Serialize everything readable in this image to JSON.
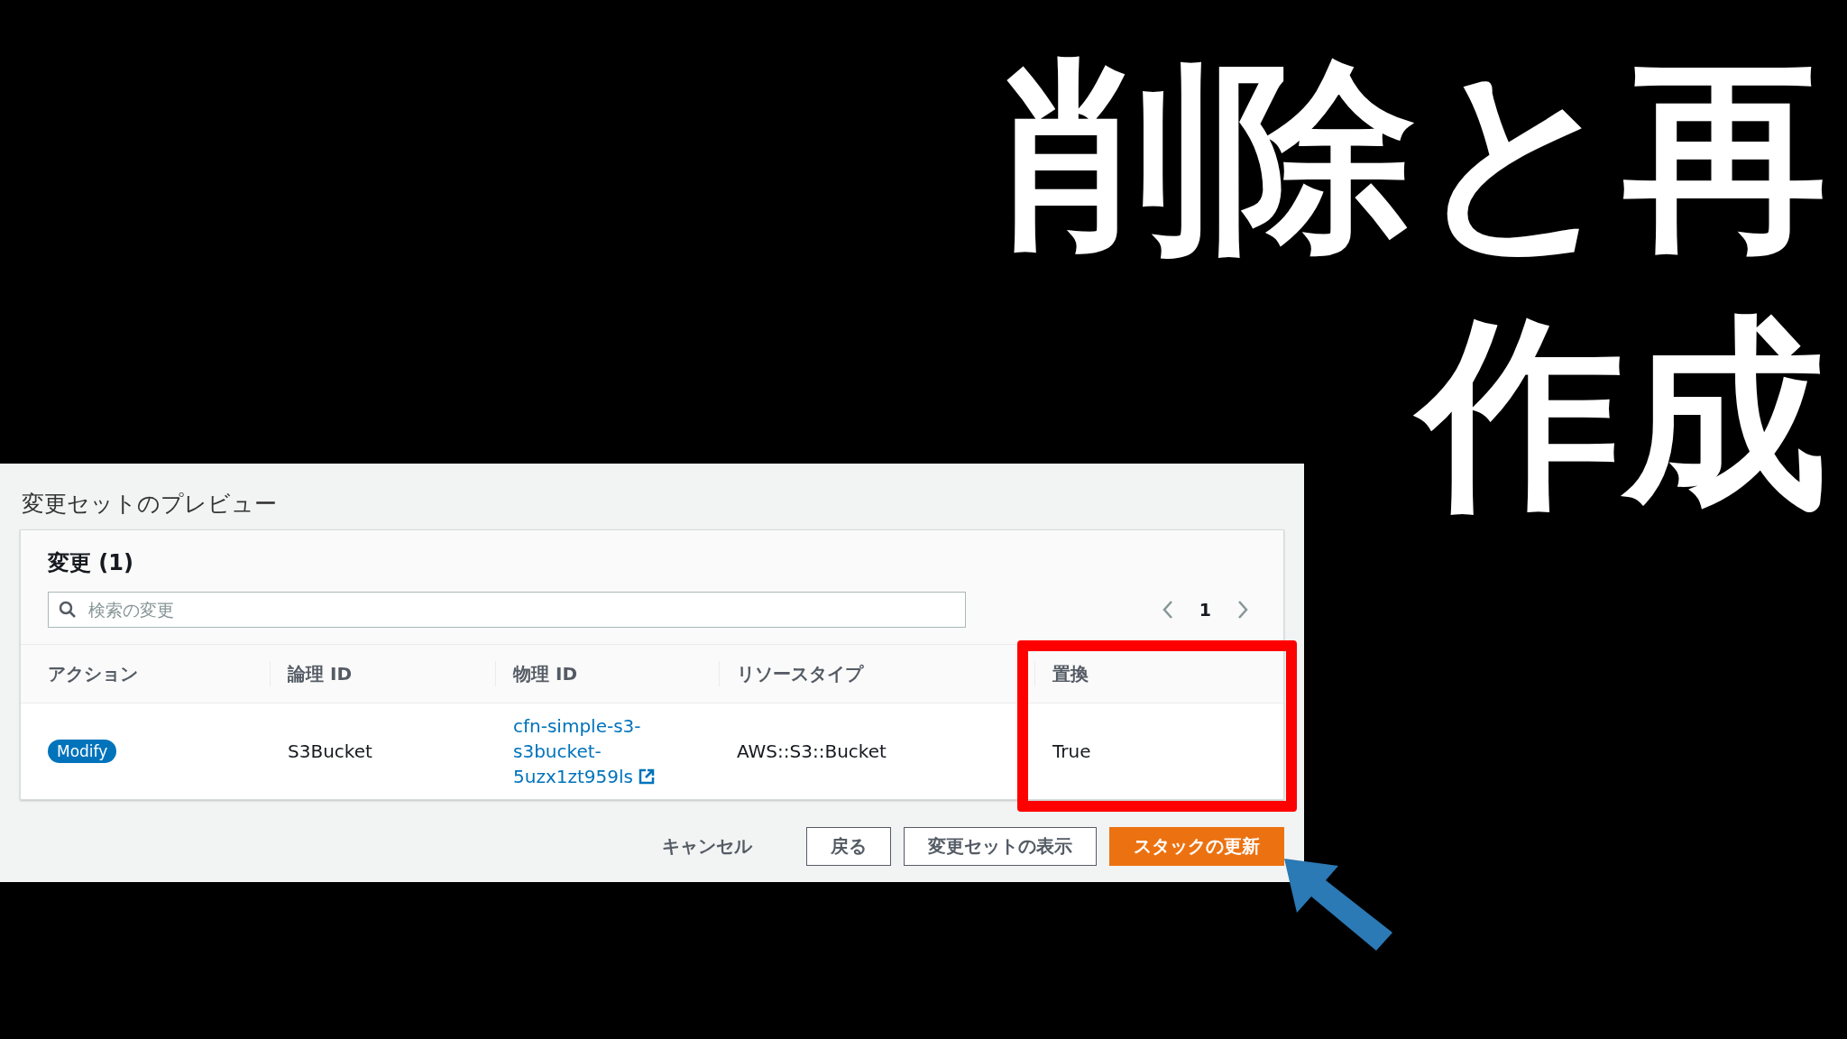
{
  "headline": {
    "lines": [
      "削除と再",
      "作成"
    ]
  },
  "panel": {
    "title": "変更セットのプレビュー",
    "heading": "変更 (1)",
    "search": {
      "placeholder": "検索の変更"
    },
    "pagination": {
      "page": "1"
    },
    "table": {
      "columns": [
        "アクション",
        "論理 ID",
        "物理 ID",
        "リソースタイプ",
        "置換"
      ],
      "rows": [
        {
          "action": "Modify",
          "logical_id": "S3Bucket",
          "physical_id": "cfn-simple-s3-s3bucket-5uzx1zt959ls",
          "resource_type": "AWS::S3::Bucket",
          "replacement": "True"
        }
      ]
    },
    "buttons": [
      {
        "label": "キャンセル",
        "kind": "link"
      },
      {
        "label": "戻る",
        "kind": "normal"
      },
      {
        "label": "変更セットの表示",
        "kind": "normal"
      },
      {
        "label": "スタックの更新",
        "kind": "primary"
      }
    ]
  }
}
